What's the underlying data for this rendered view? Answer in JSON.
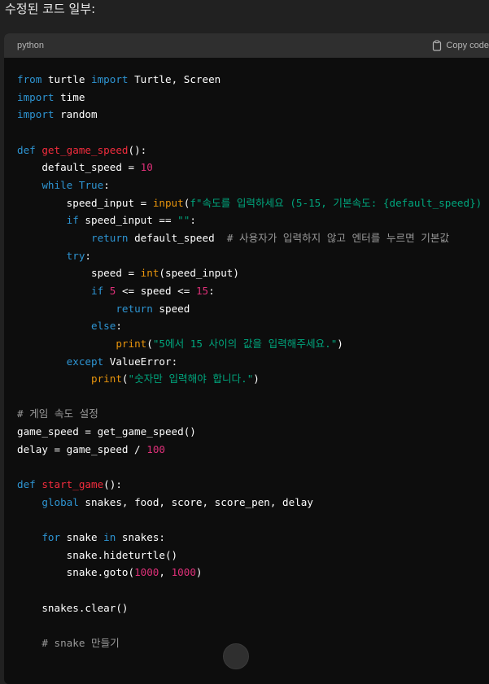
{
  "heading": "수정된 코드 일부:",
  "code_block": {
    "language": "python",
    "copy_label": "Copy code",
    "lines": [
      [
        {
          "t": "from",
          "c": "kw"
        },
        {
          "t": " turtle "
        },
        {
          "t": "import",
          "c": "kw"
        },
        {
          "t": " Turtle, Screen"
        }
      ],
      [
        {
          "t": "import",
          "c": "kw"
        },
        {
          "t": " time"
        }
      ],
      [
        {
          "t": "import",
          "c": "kw"
        },
        {
          "t": " random"
        }
      ],
      [],
      [
        {
          "t": "def",
          "c": "kw"
        },
        {
          "t": " "
        },
        {
          "t": "get_game_speed",
          "c": "fn"
        },
        {
          "t": "():"
        }
      ],
      [
        {
          "t": "    default_speed = "
        },
        {
          "t": "10",
          "c": "num"
        }
      ],
      [
        {
          "t": "    "
        },
        {
          "t": "while",
          "c": "kw"
        },
        {
          "t": " "
        },
        {
          "t": "True",
          "c": "kw"
        },
        {
          "t": ":"
        }
      ],
      [
        {
          "t": "        speed_input = "
        },
        {
          "t": "input",
          "c": "bi"
        },
        {
          "t": "("
        },
        {
          "t": "f\"속도를 입력하세요 (5-15, 기본속도: {default_speed})",
          "c": "str"
        }
      ],
      [
        {
          "t": "        "
        },
        {
          "t": "if",
          "c": "kw"
        },
        {
          "t": " speed_input == "
        },
        {
          "t": "\"\"",
          "c": "str"
        },
        {
          "t": ":"
        }
      ],
      [
        {
          "t": "            "
        },
        {
          "t": "return",
          "c": "kw"
        },
        {
          "t": " default_speed  "
        },
        {
          "t": "# 사용자가 입력하지 않고 엔터를 누르면 기본값",
          "c": "cm"
        }
      ],
      [
        {
          "t": "        "
        },
        {
          "t": "try",
          "c": "kw"
        },
        {
          "t": ":"
        }
      ],
      [
        {
          "t": "            speed = "
        },
        {
          "t": "int",
          "c": "bi"
        },
        {
          "t": "(speed_input)"
        }
      ],
      [
        {
          "t": "            "
        },
        {
          "t": "if",
          "c": "kw"
        },
        {
          "t": " "
        },
        {
          "t": "5",
          "c": "num"
        },
        {
          "t": " <= speed <= "
        },
        {
          "t": "15",
          "c": "num"
        },
        {
          "t": ":"
        }
      ],
      [
        {
          "t": "                "
        },
        {
          "t": "return",
          "c": "kw"
        },
        {
          "t": " speed"
        }
      ],
      [
        {
          "t": "            "
        },
        {
          "t": "else",
          "c": "kw"
        },
        {
          "t": ":"
        }
      ],
      [
        {
          "t": "                "
        },
        {
          "t": "print",
          "c": "bi"
        },
        {
          "t": "("
        },
        {
          "t": "\"5에서 15 사이의 값을 입력해주세요.\"",
          "c": "str"
        },
        {
          "t": ")"
        }
      ],
      [
        {
          "t": "        "
        },
        {
          "t": "except",
          "c": "kw"
        },
        {
          "t": " ValueError:"
        }
      ],
      [
        {
          "t": "            "
        },
        {
          "t": "print",
          "c": "bi"
        },
        {
          "t": "("
        },
        {
          "t": "\"숫자만 입력해야 합니다.\"",
          "c": "str"
        },
        {
          "t": ")"
        }
      ],
      [],
      [
        {
          "t": "# 게임 속도 설정",
          "c": "cm"
        }
      ],
      [
        {
          "t": "game_speed = get_game_speed()"
        }
      ],
      [
        {
          "t": "delay = game_speed / "
        },
        {
          "t": "100",
          "c": "num"
        }
      ],
      [],
      [
        {
          "t": "def",
          "c": "kw"
        },
        {
          "t": " "
        },
        {
          "t": "start_game",
          "c": "fn"
        },
        {
          "t": "():"
        }
      ],
      [
        {
          "t": "    "
        },
        {
          "t": "global",
          "c": "kw"
        },
        {
          "t": " snakes, food, score, score_pen, delay"
        }
      ],
      [],
      [
        {
          "t": "    "
        },
        {
          "t": "for",
          "c": "kw"
        },
        {
          "t": " snake "
        },
        {
          "t": "in",
          "c": "kw"
        },
        {
          "t": " snakes:"
        }
      ],
      [
        {
          "t": "        snake.hideturtle()"
        }
      ],
      [
        {
          "t": "        snake.goto("
        },
        {
          "t": "1000",
          "c": "num"
        },
        {
          "t": ", "
        },
        {
          "t": "1000",
          "c": "num"
        },
        {
          "t": ")"
        }
      ],
      [],
      [
        {
          "t": "    snakes.clear()"
        }
      ],
      [],
      [
        {
          "t": "    "
        },
        {
          "t": "# snake 만들기",
          "c": "cm"
        }
      ]
    ]
  }
}
